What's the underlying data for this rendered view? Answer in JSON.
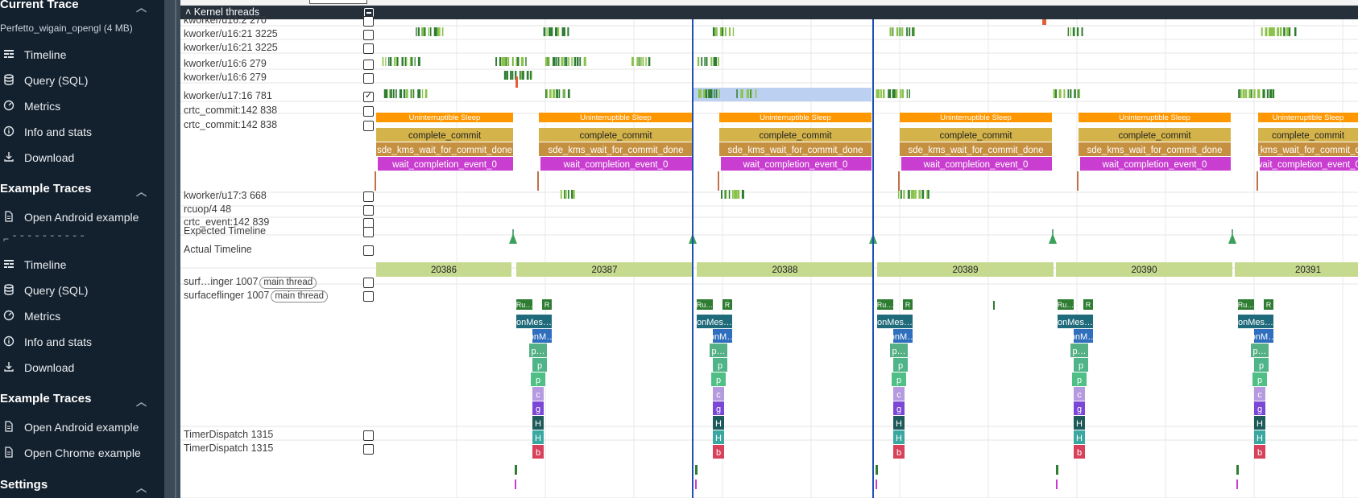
{
  "sidebar": {
    "sections": [
      {
        "title": "Current Trace",
        "subtitle": "Perfetto_wigain_opengl (4 MB)",
        "items": [
          {
            "label": "Timeline",
            "icon": "timeline-icon"
          },
          {
            "label": "Query (SQL)",
            "icon": "database-icon"
          },
          {
            "label": "Metrics",
            "icon": "gauge-icon"
          },
          {
            "label": "Info and stats",
            "icon": "info-icon"
          },
          {
            "label": "Download",
            "icon": "download-icon"
          }
        ]
      },
      {
        "title": "Example Traces",
        "items": [
          {
            "label": "Open Android example",
            "icon": "file-icon"
          },
          {
            "label": "Timeline",
            "icon": "timeline-icon"
          },
          {
            "label": "Query (SQL)",
            "icon": "database-icon"
          },
          {
            "label": "Metrics",
            "icon": "gauge-icon"
          },
          {
            "label": "Info and stats",
            "icon": "info-icon"
          },
          {
            "label": "Download",
            "icon": "download-icon"
          }
        ]
      },
      {
        "title": "Example Traces",
        "items": [
          {
            "label": "Open Android example",
            "icon": "file-icon"
          },
          {
            "label": "Open Chrome example",
            "icon": "file-icon"
          }
        ]
      },
      {
        "title": "Settings",
        "items": []
      }
    ]
  },
  "timeline": {
    "group_title": "Kernel threads",
    "tracks": [
      {
        "name": "kworker/u16:2 270",
        "checked": false
      },
      {
        "name": "kworker/u16:21 3225",
        "checked": false
      },
      {
        "name": "kworker/u16:21 3225",
        "checked": false
      },
      {
        "name": "kworker/u16:6 279",
        "checked": false
      },
      {
        "name": "kworker/u16:6 279",
        "checked": false
      },
      {
        "name": "kworker/u17:16 781",
        "checked": true
      },
      {
        "name": "crtc_commit:142 838",
        "checked": false
      },
      {
        "name": "crtc_commit:142 838",
        "checked": false
      },
      {
        "name": "kworker/u17:3 668",
        "checked": false
      },
      {
        "name": "rcuop/4 48",
        "checked": false
      },
      {
        "name": "crtc_event:142 839",
        "checked": false
      },
      {
        "name": "Expected Timeline",
        "checked": false
      },
      {
        "name": "Actual Timeline",
        "checked": false
      },
      {
        "name": "surf…inger 1007",
        "tag": "main thread",
        "checked": false
      },
      {
        "name": "surfaceflinger 1007",
        "tag": "main thread",
        "checked": false
      },
      {
        "name": "TimerDispatch 1315",
        "checked": false
      },
      {
        "name": "TimerDispatch 1315",
        "checked": false
      }
    ],
    "sleep_label": "Uninterruptible Sleep",
    "slice_labels": [
      "complete_commit",
      "sde_kms_wait_for_commit_done",
      "wait_completion_event_0"
    ],
    "frame_numbers": [
      "20386",
      "20387",
      "20388",
      "20389",
      "20390",
      "20391"
    ],
    "sf_small_labels": [
      "Ru…",
      "R"
    ],
    "sf_stack_labels": [
      "onMes…",
      "onM…",
      "p…",
      "p",
      "p",
      "c",
      "g",
      "H",
      "H",
      "b"
    ],
    "colors": {
      "sleep": "#ff9800",
      "commit": "#d4b44a",
      "sde": "#c59040",
      "wait": "#c93ed0",
      "frame": "#c5da8f",
      "sched_light": "#8bc34a",
      "sched_dark": "#2e7d32",
      "selection": "#bcd1f2",
      "cursor": "#1e4fb4",
      "sidebar_bg": "#13202d"
    }
  }
}
